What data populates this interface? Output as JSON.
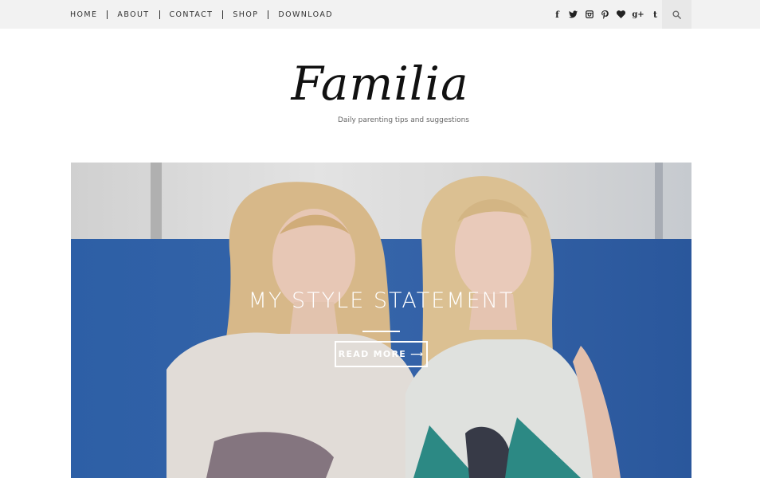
{
  "nav": {
    "items": [
      {
        "label": "HOME"
      },
      {
        "label": "ABOUT"
      },
      {
        "label": "CONTACT"
      },
      {
        "label": "SHOP"
      },
      {
        "label": "DOWNLOAD"
      }
    ]
  },
  "social": {
    "icons": [
      "facebook-icon",
      "twitter-icon",
      "instagram-icon",
      "pinterest-icon",
      "heart-icon",
      "google-plus-icon",
      "tumblr-icon"
    ],
    "facebook_glyph": "f",
    "google_glyph": "g+",
    "tumblr_glyph": "t"
  },
  "search": {
    "icon": "search-icon"
  },
  "site": {
    "title": "Familia",
    "tagline": "Daily parenting tips and suggestions"
  },
  "hero": {
    "title": "MY STYLE STATEMENT",
    "button_label": "READ MORE ⟶"
  },
  "colors": {
    "topbar_bg": "#f2f2f2",
    "hero_blue": "#2f5aa1",
    "text": "#333333",
    "white": "#ffffff"
  }
}
